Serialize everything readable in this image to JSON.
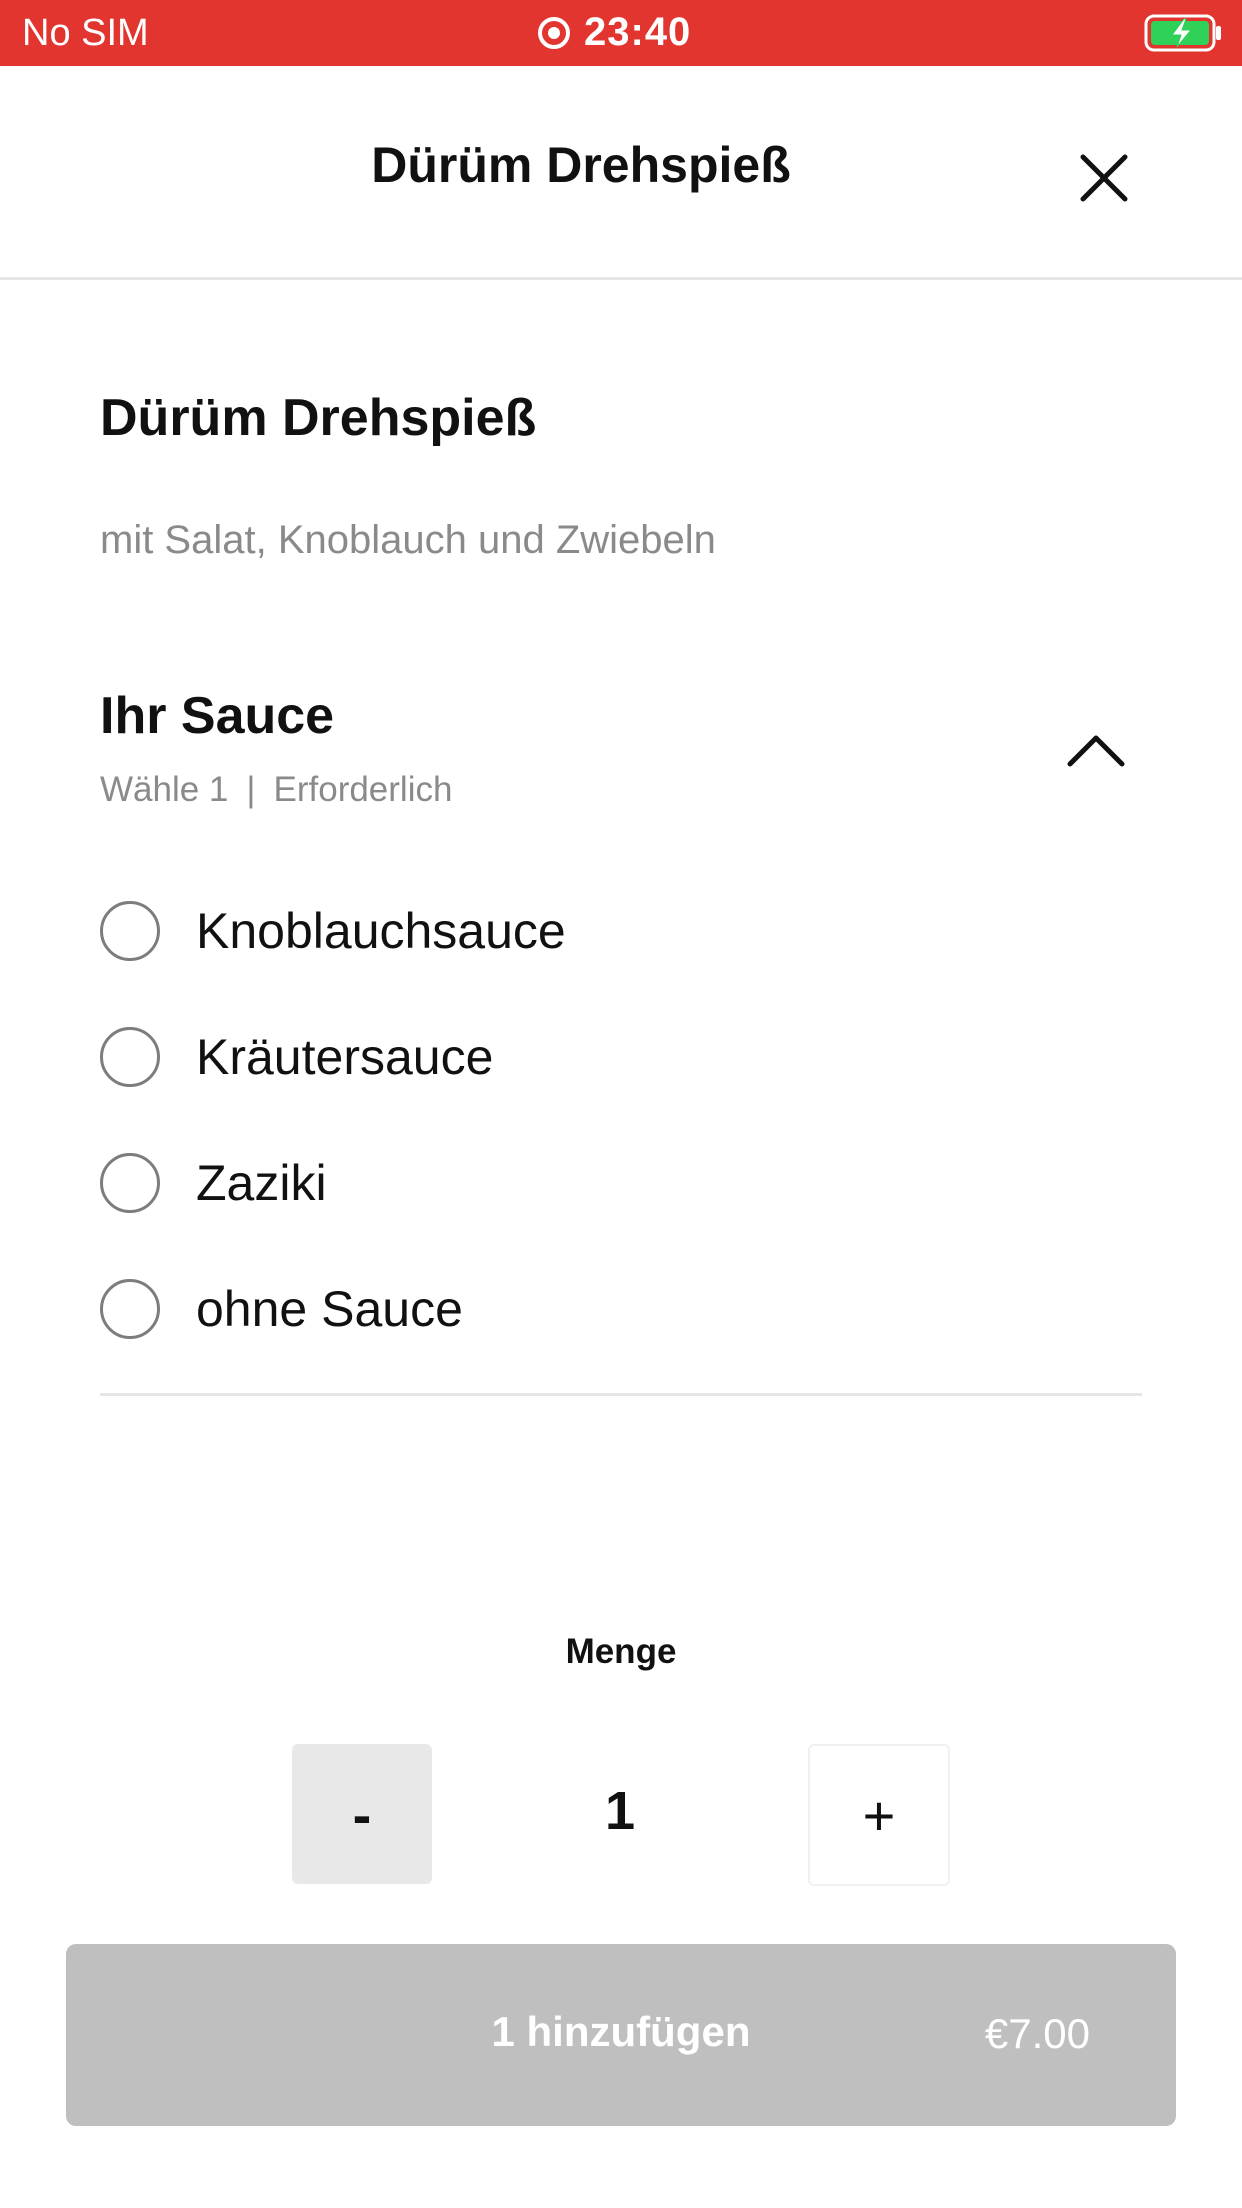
{
  "status_bar": {
    "carrier": "No SIM",
    "time": "23:40",
    "background_color": "#e23530",
    "record_icon": "screen-record-icon",
    "battery_icon": "battery-charging-icon"
  },
  "header": {
    "title": "Dürüm Drehspieß",
    "close_icon": "close-icon"
  },
  "product": {
    "title": "Dürüm Drehspieß",
    "description": "mit Salat, Knoblauch und Zwiebeln"
  },
  "option_group": {
    "title": "Ihr Sauce",
    "choose_hint": "Wähle 1",
    "separator": "|",
    "required_label": "Erforderlich",
    "expanded": true,
    "options": [
      {
        "label": "Knoblauchsauce",
        "selected": false
      },
      {
        "label": "Kräutersauce",
        "selected": false
      },
      {
        "label": "Zaziki",
        "selected": false
      },
      {
        "label": "ohne Sauce",
        "selected": false
      }
    ]
  },
  "quantity": {
    "label": "Menge",
    "value": "1",
    "minus_label": "-",
    "plus_label": "+"
  },
  "add_button": {
    "label": "1 hinzufügen",
    "price": "€7.00",
    "disabled": true,
    "background_color": "#bfbfbf"
  }
}
